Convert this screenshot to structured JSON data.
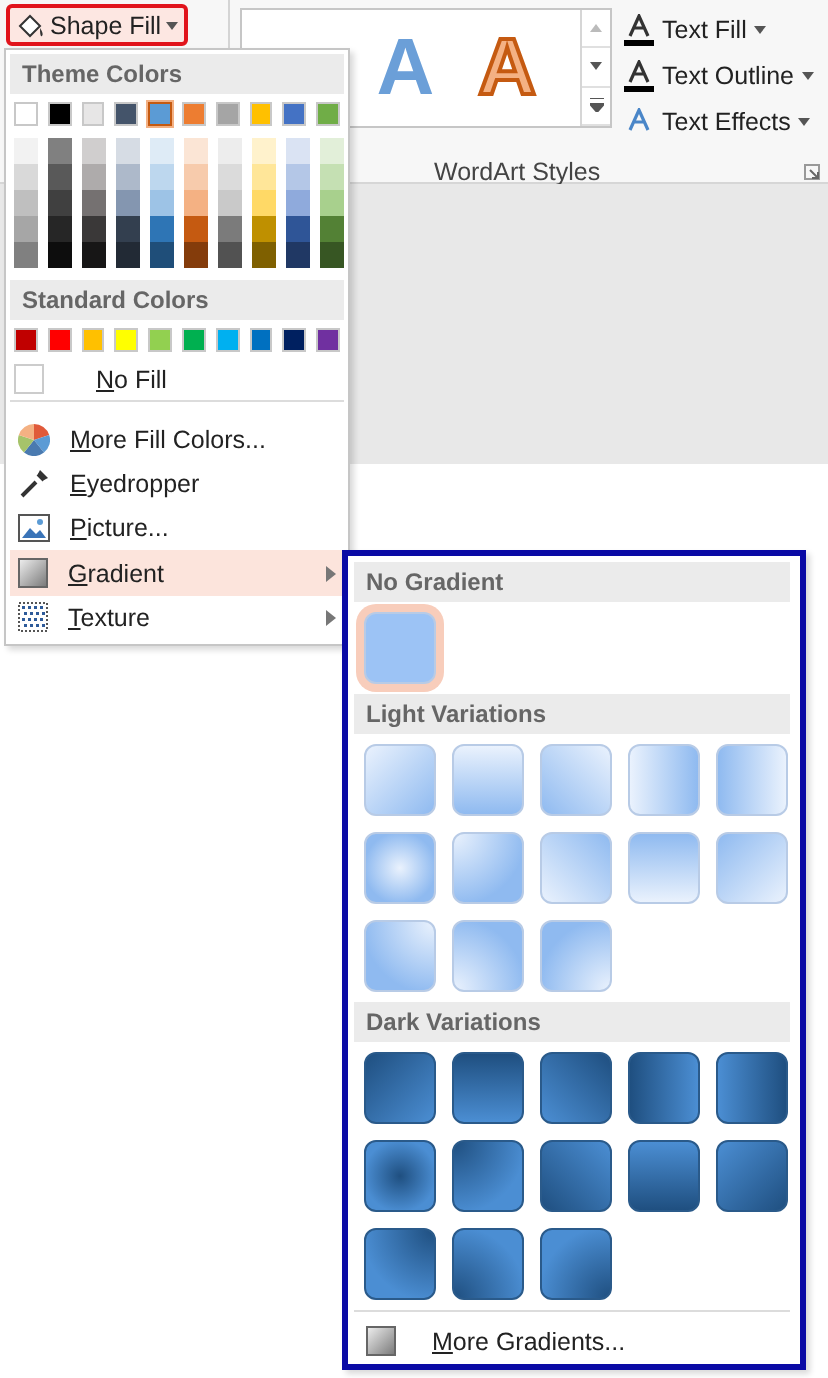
{
  "ribbon": {
    "shape_fill": {
      "label": "Shape Fill",
      "pressed": true
    },
    "wordart_gallery": [
      {
        "letter": "A",
        "kind": "blue"
      },
      {
        "letter": "A",
        "kind": "orange"
      }
    ],
    "text_buttons": [
      {
        "label": "Text Fill",
        "kind": "fill"
      },
      {
        "label": "Text Outline",
        "kind": "outline"
      },
      {
        "label": "Text Effects",
        "kind": "effects"
      }
    ],
    "group_label": "WordArt Styles"
  },
  "shape_fill_menu": {
    "theme_header": "Theme Colors",
    "theme_colors": [
      {
        "color": "#ffffff",
        "selected": false,
        "shades": [
          {
            "color": "#f2f2f2"
          },
          {
            "color": "#d9d9d9"
          },
          {
            "color": "#bfbfbf"
          },
          {
            "color": "#a6a6a6"
          },
          {
            "color": "#808080"
          }
        ]
      },
      {
        "color": "#000000",
        "selected": false,
        "shades": [
          {
            "color": "#808080"
          },
          {
            "color": "#595959"
          },
          {
            "color": "#404040"
          },
          {
            "color": "#262626"
          },
          {
            "color": "#0d0d0d"
          }
        ]
      },
      {
        "color": "#e7e6e6",
        "selected": false,
        "shades": [
          {
            "color": "#d0cece"
          },
          {
            "color": "#aeabab"
          },
          {
            "color": "#757171"
          },
          {
            "color": "#3a3838"
          },
          {
            "color": "#171616"
          }
        ]
      },
      {
        "color": "#44546a",
        "selected": false,
        "shades": [
          {
            "color": "#d6dce4"
          },
          {
            "color": "#adb9ca"
          },
          {
            "color": "#8496b0"
          },
          {
            "color": "#333f4f"
          },
          {
            "color": "#222a35"
          }
        ]
      },
      {
        "color": "#5b9bd5",
        "selected": true,
        "shades": [
          {
            "color": "#deebf6"
          },
          {
            "color": "#bdd7ee"
          },
          {
            "color": "#9dc3e6"
          },
          {
            "color": "#2e75b5"
          },
          {
            "color": "#1f4e79"
          }
        ]
      },
      {
        "color": "#ed7d31",
        "selected": false,
        "shades": [
          {
            "color": "#fbe5d5"
          },
          {
            "color": "#f7cbac"
          },
          {
            "color": "#f4b183"
          },
          {
            "color": "#c55a11"
          },
          {
            "color": "#843c0b"
          }
        ]
      },
      {
        "color": "#a5a5a5",
        "selected": false,
        "shades": [
          {
            "color": "#ededed"
          },
          {
            "color": "#dbdbdb"
          },
          {
            "color": "#c9c9c9"
          },
          {
            "color": "#7b7b7b"
          },
          {
            "color": "#525252"
          }
        ]
      },
      {
        "color": "#ffc000",
        "selected": false,
        "shades": [
          {
            "color": "#fff2cc"
          },
          {
            "color": "#ffe699"
          },
          {
            "color": "#ffd966"
          },
          {
            "color": "#bf9000"
          },
          {
            "color": "#7f6000"
          }
        ]
      },
      {
        "color": "#4472c4",
        "selected": false,
        "shades": [
          {
            "color": "#dae3f3"
          },
          {
            "color": "#b4c7e7"
          },
          {
            "color": "#8faadc"
          },
          {
            "color": "#2f5597"
          },
          {
            "color": "#203864"
          }
        ]
      },
      {
        "color": "#70ad47",
        "selected": false,
        "shades": [
          {
            "color": "#e2efd9"
          },
          {
            "color": "#c5e0b3"
          },
          {
            "color": "#a8d08d"
          },
          {
            "color": "#538135"
          },
          {
            "color": "#375623"
          }
        ]
      }
    ],
    "standard_header": "Standard Colors",
    "standard_colors": [
      {
        "color": "#c00000"
      },
      {
        "color": "#ff0000"
      },
      {
        "color": "#ffc000"
      },
      {
        "color": "#ffff00"
      },
      {
        "color": "#92d050"
      },
      {
        "color": "#00b050"
      },
      {
        "color": "#00b0f0"
      },
      {
        "color": "#0070c0"
      },
      {
        "color": "#002060"
      },
      {
        "color": "#7030a0"
      }
    ],
    "no_fill": "No Fill",
    "items": [
      {
        "label": "More Fill Colors...",
        "kind": "palette",
        "has_submenu": false,
        "highlighted": false
      },
      {
        "label": "Eyedropper",
        "kind": "eyedropper",
        "has_submenu": false,
        "highlighted": false
      },
      {
        "label": "Picture...",
        "kind": "picture",
        "has_submenu": false,
        "highlighted": false
      },
      {
        "label": "Gradient",
        "kind": "gradient",
        "has_submenu": true,
        "highlighted": true
      },
      {
        "label": "Texture",
        "kind": "texture",
        "has_submenu": true,
        "highlighted": false
      }
    ]
  },
  "gradient_menu": {
    "sections": [
      {
        "header": "No Gradient",
        "kind": "flat",
        "swatches": [
          {
            "selected": true
          }
        ]
      },
      {
        "header": "Light Variations",
        "kind": "light",
        "swatches": [
          {
            "selected": false
          },
          {
            "selected": false
          },
          {
            "selected": false
          },
          {
            "selected": false
          },
          {
            "selected": false
          },
          {
            "selected": false
          },
          {
            "selected": false
          },
          {
            "selected": false
          },
          {
            "selected": false
          },
          {
            "selected": false
          },
          {
            "selected": false
          },
          {
            "selected": false
          },
          {
            "selected": false
          }
        ]
      },
      {
        "header": "Dark Variations",
        "kind": "dark",
        "swatches": [
          {
            "selected": false
          },
          {
            "selected": false
          },
          {
            "selected": false
          },
          {
            "selected": false
          },
          {
            "selected": false
          },
          {
            "selected": false
          },
          {
            "selected": false
          },
          {
            "selected": false
          },
          {
            "selected": false
          },
          {
            "selected": false
          },
          {
            "selected": false
          },
          {
            "selected": false
          },
          {
            "selected": false
          }
        ]
      }
    ],
    "more": "More Gradients..."
  }
}
